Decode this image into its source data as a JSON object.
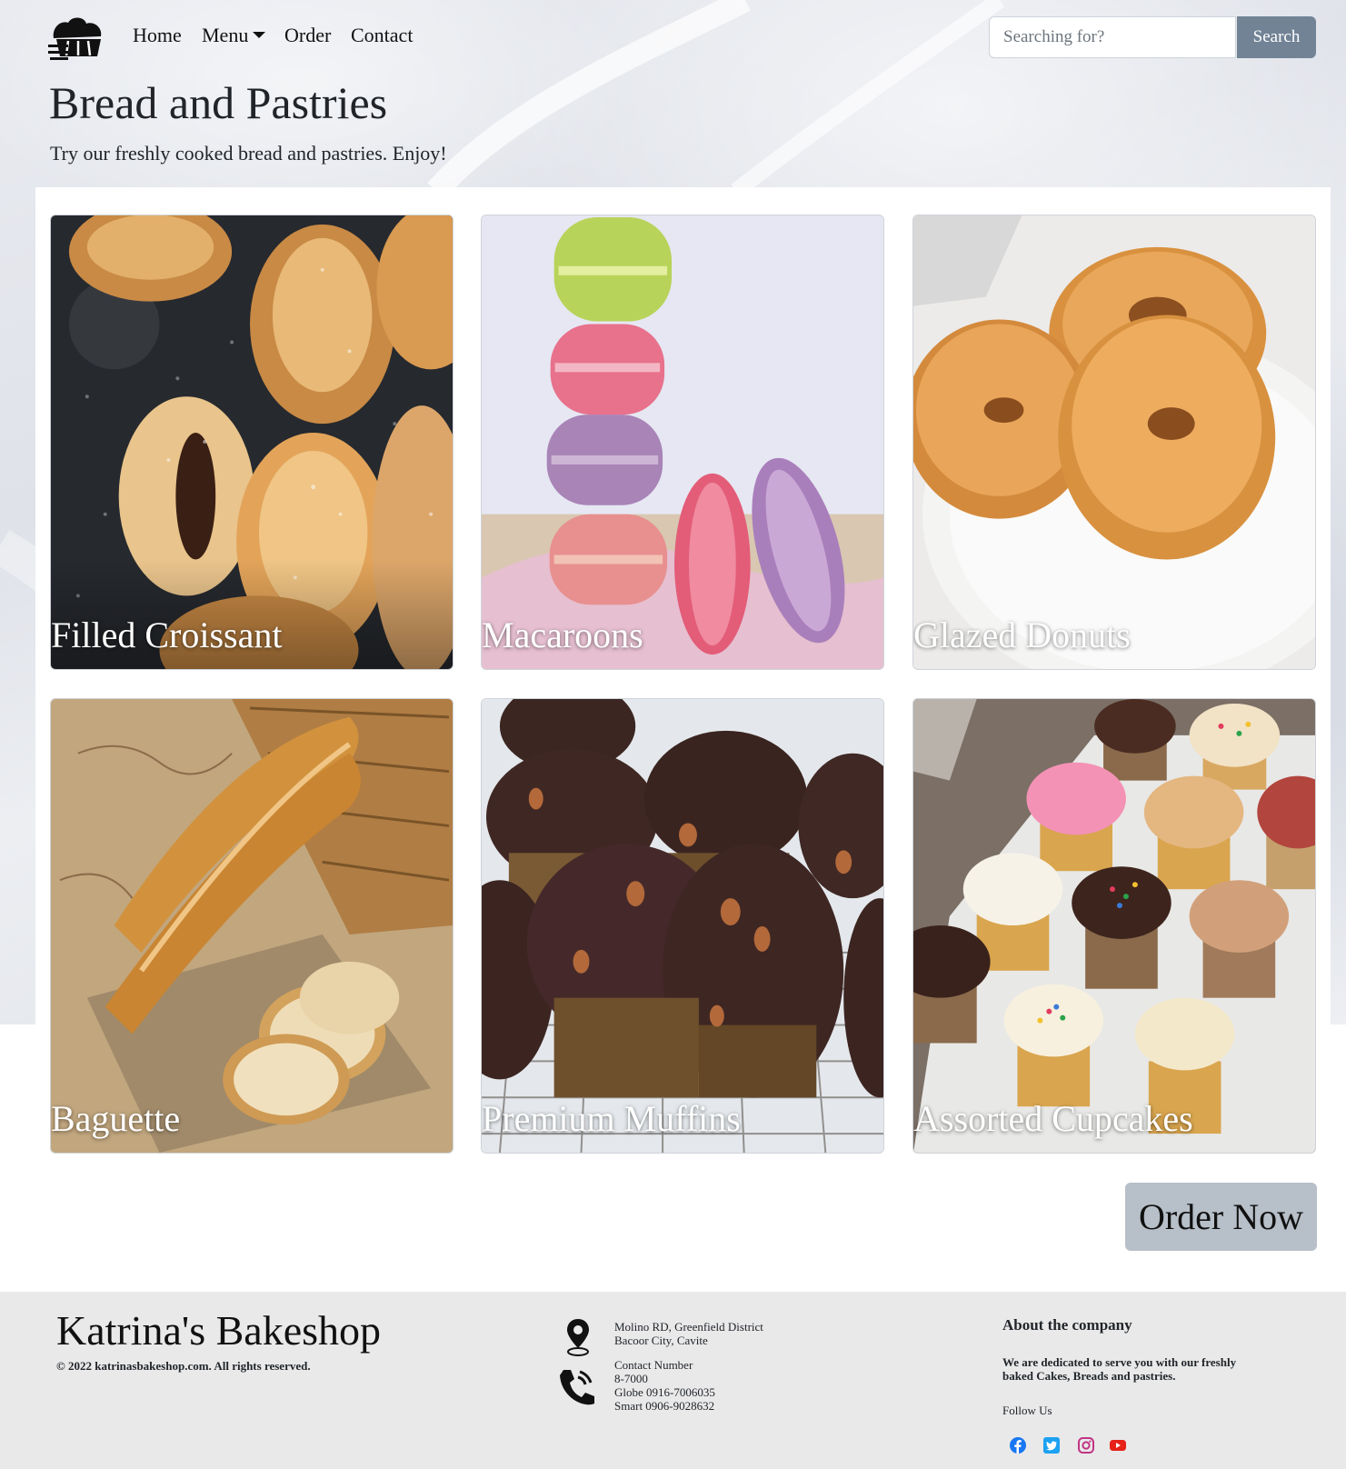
{
  "nav": {
    "logo": "bakeshop-logo",
    "links": [
      "Home",
      "Menu",
      "Order",
      "Contact"
    ],
    "search_placeholder": "Searching for?",
    "search_button": "Search"
  },
  "hero": {
    "title": "Bread and Pastries",
    "subtitle": "Try our freshly cooked bread and pastries. Enjoy!"
  },
  "products": [
    {
      "name": "Filled Croissant"
    },
    {
      "name": "Macaroons"
    },
    {
      "name": "Glazed Donuts"
    },
    {
      "name": "Baguette"
    },
    {
      "name": "Premium Muffins"
    },
    {
      "name": "Assorted Cupcakes"
    }
  ],
  "order_button": "Order Now",
  "footer": {
    "brand": "Katrina's Bakeshop",
    "copyright": "2022 katrinasbakeshop.com. All rights reserved.",
    "address_line1": "Molino RD, Greenfield District",
    "address_line2": "Bacoor City, Cavite",
    "contact_heading": "Contact Number",
    "contact_1": "8-7000",
    "contact_2": "Globe 0916-7006035",
    "contact_3": "Smart 0906-9028632",
    "about_heading": "About the company",
    "about_text": "We are dedicated to serve you with our freshly baked Cakes, Breads and pastries.",
    "follow_label": "Follow Us",
    "social": [
      "facebook-icon",
      "twitter-icon",
      "instagram-icon",
      "youtube-icon"
    ]
  },
  "colors": {
    "search_button": "#728396",
    "order_button": "#b7bfc8",
    "footer_bg": "#e9e9ea",
    "facebook": "#1877f2",
    "twitter": "#1da1f2",
    "instagram": "#c13584",
    "youtube": "#e62117"
  }
}
